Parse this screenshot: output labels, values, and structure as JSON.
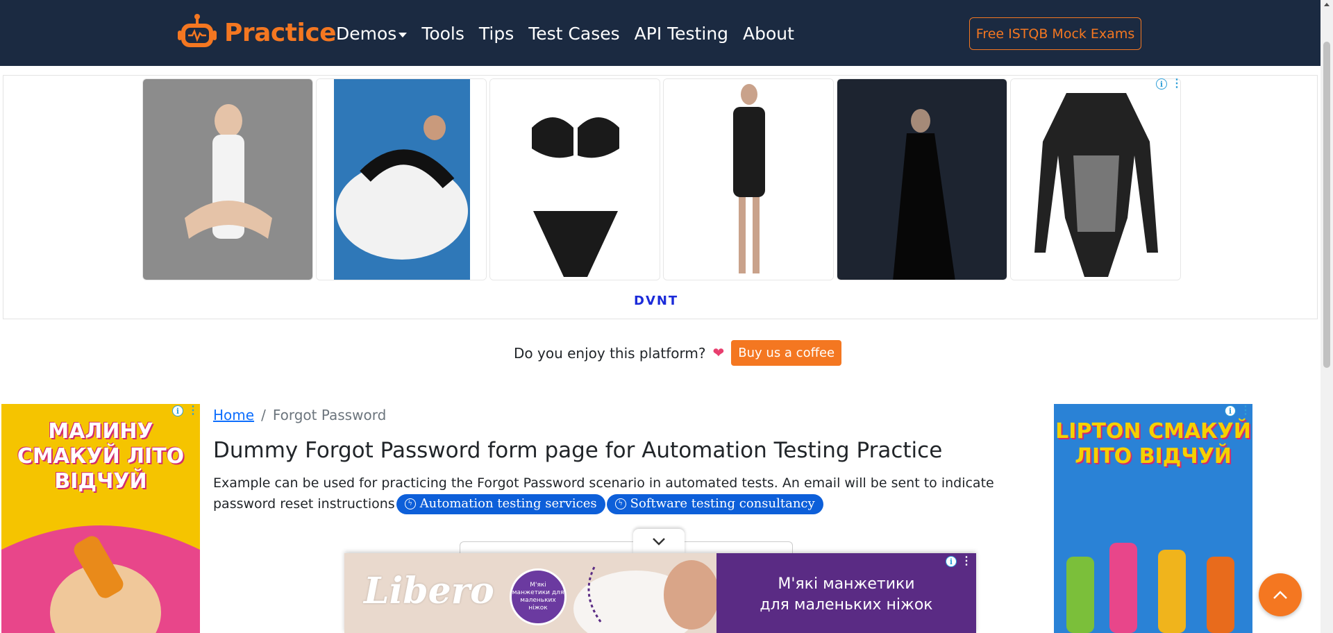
{
  "navbar": {
    "brand": "Practice",
    "links": [
      {
        "label": "Demos",
        "dropdown": true
      },
      {
        "label": "Tools"
      },
      {
        "label": "Tips"
      },
      {
        "label": "Test Cases"
      },
      {
        "label": "API Testing"
      },
      {
        "label": "About"
      }
    ],
    "cta": "Free ISTQB Mock Exams"
  },
  "top_ad": {
    "brand": "DVNT"
  },
  "coffee": {
    "text": "Do you enjoy this platform?",
    "button": "Buy us a coffee"
  },
  "side_ads": {
    "left_headline": "МАЛИНУ СМАКУЙ ЛІТО ВІДЧУЙ",
    "right_headline": "LIPTON СМАКУЙ ЛІТО ВІДЧУЙ"
  },
  "breadcrumb": {
    "home": "Home",
    "separator": "/",
    "current": "Forgot Password"
  },
  "page": {
    "title": "Dummy Forgot Password form page for Automation Testing Practice",
    "description": "Example can be used for practicing the Forgot Password scenario in automated tests. An email will be sent to indicate password reset instructions",
    "chips": [
      "Automation testing services",
      "Software testing consultancy"
    ]
  },
  "bottom_ad": {
    "brand": "Libero",
    "badge": "М'які манжетики для маленьких ніжок",
    "slogan_line1": "М'які манжетики",
    "slogan_line2": "для маленьких ніжок"
  },
  "colors": {
    "navbar_bg": "#1b2a41",
    "accent": "#f47721",
    "link": "#0d6efd"
  }
}
